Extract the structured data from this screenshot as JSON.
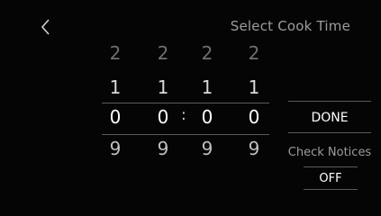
{
  "header": {
    "back_glyph": "<",
    "title": "Select Cook Time"
  },
  "picker": {
    "separator": ":",
    "columns": [
      {
        "rows": [
          "2",
          "1",
          "0",
          "9"
        ]
      },
      {
        "rows": [
          "2",
          "1",
          "0",
          "9"
        ]
      },
      {
        "rows": [
          "2",
          "1",
          "0",
          "9"
        ]
      },
      {
        "rows": [
          "2",
          "1",
          "0",
          "9"
        ]
      }
    ]
  },
  "actions": {
    "done_label": "DONE",
    "check_notices_label": "Check Notices",
    "notices_value": "OFF"
  },
  "colors": {
    "background": "#050505",
    "text_primary": "#ffffff",
    "text_secondary": "#9c9c9c",
    "divider": "#5a5a5a"
  }
}
